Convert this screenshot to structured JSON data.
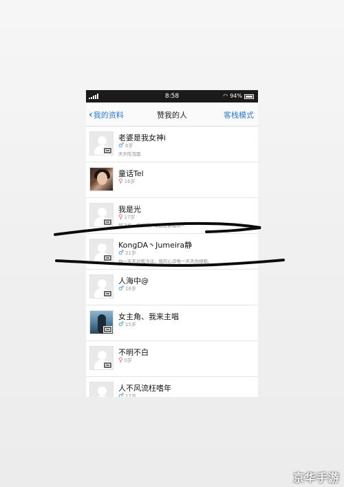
{
  "status_bar": {
    "time": "8:58",
    "battery": "94%"
  },
  "nav": {
    "back_label": "我的资料",
    "title": "赞我的人",
    "right_label": "客栈模式"
  },
  "contacts": [
    {
      "name": "老婆是我女神i",
      "gender": "male",
      "age": "0岁",
      "signature": "天天吃泡面",
      "avatar": "placeholder"
    },
    {
      "name": "童话Tel",
      "gender": "female",
      "age": "16岁",
      "signature": "",
      "avatar": "photo1"
    },
    {
      "name": "我是光",
      "gender": "female",
      "age": "17岁",
      "signature": "超飞机，蜗蜗哥，每屁股跟着你~",
      "avatar": "placeholder"
    },
    {
      "name": "KongDA丶Jumeira静",
      "gender": "male",
      "age": "21岁",
      "signature": "你一天天对我冷淡，我的心凉唯一天天你顺眼。",
      "avatar": "placeholder"
    },
    {
      "name": "人海中@",
      "gender": "male",
      "age": "16岁",
      "signature": "",
      "avatar": "placeholder"
    },
    {
      "name": "女主角、我来主唱",
      "gender": "male",
      "age": "15岁",
      "signature": "",
      "avatar": "photo2"
    },
    {
      "name": "不明不白",
      "gender": "female",
      "age": "0岁",
      "signature": "",
      "avatar": "placeholder"
    },
    {
      "name": "人不风流枉嗜年",
      "gender": "male",
      "age": "17岁",
      "signature": "",
      "avatar": "placeholder"
    }
  ],
  "watermark": "京华手游",
  "colors": {
    "accent": "#2a7ad6",
    "male": "#3a8fd8",
    "female": "#e2657c",
    "statusbar": "#1b1b1b"
  }
}
